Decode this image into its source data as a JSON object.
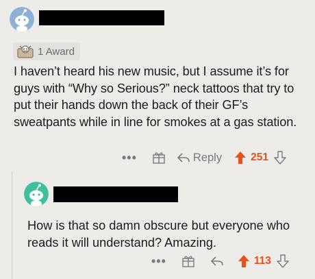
{
  "comment": {
    "award_label": "1 Award",
    "body": "I haven’t heard his new music, but I assume it’s for guys with “Why so Serious?” neck tattoos that try to put their hands down the back of their GF’s sweatpants while in line for smokes at a gas station.",
    "actions": {
      "more": "•••",
      "reply_label": "Reply",
      "score": "251"
    }
  },
  "reply": {
    "body": "How is that so damn obscure but everyone who reads it will understand? Amazing.",
    "actions": {
      "more": "•••",
      "score": "113"
    }
  },
  "colors": {
    "background": "#edece9",
    "upvote": "#e8501c",
    "avatar_blue": "#8fb0d6",
    "avatar_teal": "#3fbf9d",
    "redaction": "#000000"
  },
  "icons": [
    "snoo-avatar-icon",
    "award-icon",
    "give-award-icon",
    "reply-arrow-icon",
    "upvote-arrow-icon",
    "downvote-arrow-icon"
  ]
}
